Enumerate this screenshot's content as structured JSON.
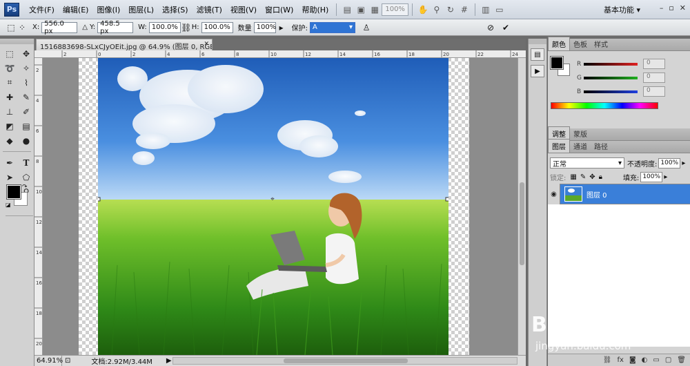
{
  "menubar": {
    "logo": "Ps",
    "items": [
      "文件(F)",
      "编辑(E)",
      "图像(I)",
      "图层(L)",
      "选择(S)",
      "滤镜(T)",
      "视图(V)",
      "窗口(W)",
      "帮助(H)"
    ],
    "zoom_display": "100%",
    "workspace": "基本功能"
  },
  "options": {
    "x_label": "X:",
    "x_value": "556.0 px",
    "y_label": "Y:",
    "y_value": "458.5 px",
    "w_label": "W:",
    "w_value": "100.0%",
    "h_label": "H:",
    "h_value": "100.0%",
    "amount_label": "数量",
    "amount_value": "100%",
    "protect_label": "保护:",
    "protect_value": "A"
  },
  "document": {
    "tab_title": "1516883698-SLxCJyOEit.jpg @ 64.9% (图层 0, RGB/8#) *",
    "ruler_h": [
      "2",
      "0",
      "2",
      "4",
      "6",
      "8",
      "10",
      "12",
      "14",
      "16",
      "18",
      "20",
      "22",
      "24"
    ],
    "ruler_v": [
      "2",
      "4",
      "6",
      "8",
      "10",
      "12",
      "14",
      "16",
      "18",
      "20"
    ],
    "zoom": "64.91%",
    "doc_info": "文档:2.92M/3.44M"
  },
  "panels": {
    "color_tabs": [
      "颜色",
      "色板",
      "样式"
    ],
    "sliders": [
      {
        "letter": "R",
        "value": "0",
        "color": "#e02020"
      },
      {
        "letter": "G",
        "value": "0",
        "color": "#20b020"
      },
      {
        "letter": "B",
        "value": "0",
        "color": "#2040e0"
      }
    ],
    "adjust_tabs": [
      "调整",
      "蒙版"
    ],
    "layer_tabs": [
      "图层",
      "通道",
      "路径"
    ],
    "blend_mode": "正常",
    "opacity_label": "不透明度:",
    "opacity_value": "100%",
    "lock_label": "锁定:",
    "fill_label": "填充:",
    "fill_value": "100%",
    "layer_name": "图层 0"
  },
  "watermark": {
    "brand": "Baidu 经验",
    "url": "jingyan.baidu.com"
  }
}
